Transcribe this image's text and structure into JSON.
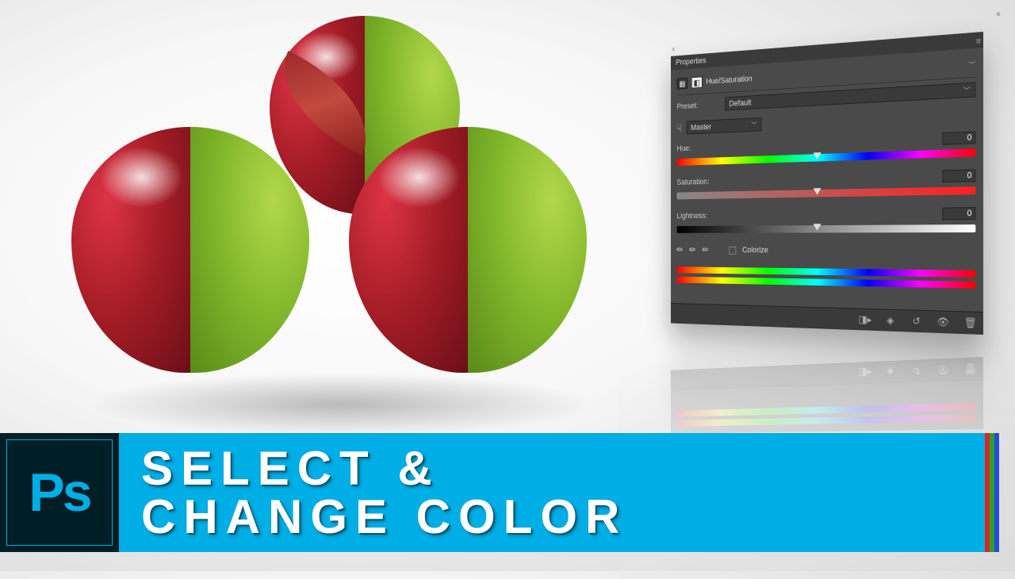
{
  "banner": {
    "logo": "Ps",
    "line1": "SELECT &",
    "line2": "CHANGE COLOR"
  },
  "panel": {
    "title": "Properties",
    "adjustment_name": "Hue/Saturation",
    "preset_label": "Preset:",
    "preset_value": "Default",
    "channel_value": "Master",
    "sliders": {
      "hue": {
        "label": "Hue:",
        "value": "0"
      },
      "saturation": {
        "label": "Saturation:",
        "value": "0"
      },
      "lightness": {
        "label": "Lightness:",
        "value": "0"
      }
    },
    "colorize_label": "Colorize",
    "footer_icons": [
      "clip-icon",
      "link-icon",
      "reset-icon",
      "visibility-icon",
      "trash-icon"
    ]
  }
}
